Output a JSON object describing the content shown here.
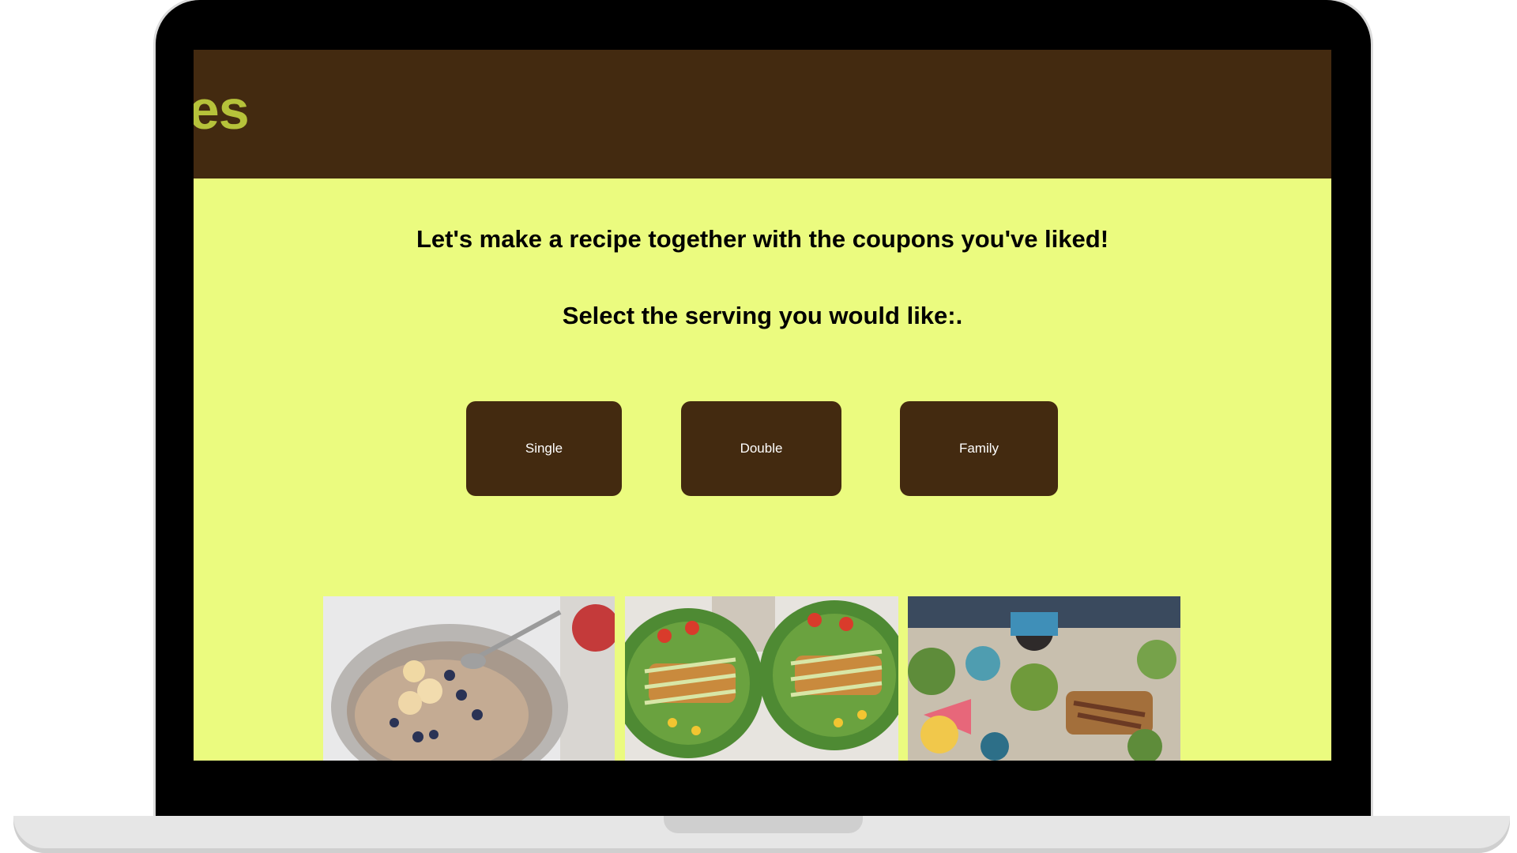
{
  "header": {
    "title_visible": "pes"
  },
  "main": {
    "intro": "Let's make a recipe together with the coupons you've liked!",
    "prompt": "Select the serving you would like:.",
    "servings": [
      {
        "label": "Single"
      },
      {
        "label": "Double"
      },
      {
        "label": "Family"
      }
    ]
  },
  "colors": {
    "page_background": "#ebfb7f",
    "header_background": "#432a10",
    "title_color": "#b6c23a",
    "button_background": "#432a10",
    "button_text": "#ffffff"
  },
  "images": [
    {
      "name": "oatmeal-bowl-photo"
    },
    {
      "name": "salad-bowls-photo"
    },
    {
      "name": "family-table-photo"
    }
  ]
}
